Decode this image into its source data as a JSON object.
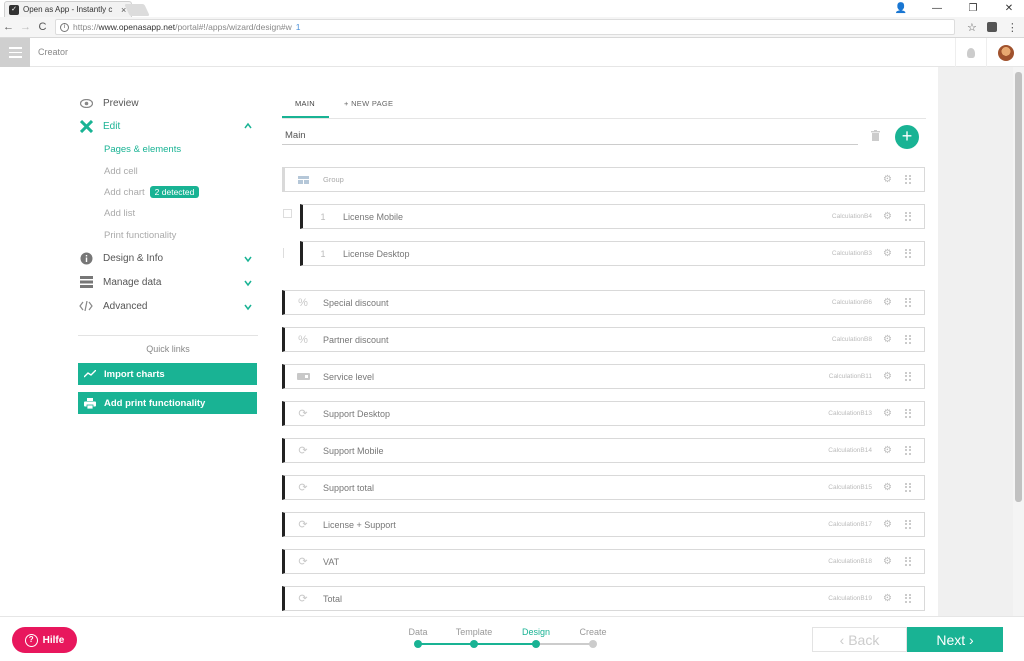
{
  "browser": {
    "tab_title": "Open as App - Instantly c",
    "tab_close": "×",
    "url_prefix": "https://",
    "url_host": "www.openasapp.net",
    "url_path": "/portal#!/apps/wizard/design#w",
    "url_suffix": "1",
    "controls": {
      "minimize": "—",
      "maximize": "❐",
      "close": "✕",
      "account": "👤"
    },
    "nav": {
      "back": "←",
      "forward": "→",
      "reload": "C"
    },
    "star": "☆",
    "menu": "⋮"
  },
  "header": {
    "title": "Creator"
  },
  "sidebar": {
    "menu": [
      {
        "label": "Preview",
        "icon": "eye-icon"
      },
      {
        "label": "Edit",
        "icon": "tools-icon",
        "active": true
      },
      {
        "label": "Design & Info",
        "icon": "info-icon"
      },
      {
        "label": "Manage data",
        "icon": "database-icon"
      },
      {
        "label": "Advanced",
        "icon": "code-icon"
      }
    ],
    "edit_submenu": [
      {
        "label": "Pages & elements",
        "active": true
      },
      {
        "label": "Add cell"
      },
      {
        "label": "Add chart",
        "badge": "2 detected"
      },
      {
        "label": "Add list"
      },
      {
        "label": "Print functionality"
      }
    ],
    "quick_links_title": "Quick links",
    "quick_links": [
      {
        "label": "Import charts",
        "icon": "chart-icon"
      },
      {
        "label": "Add print functionality",
        "icon": "printer-icon"
      }
    ]
  },
  "main": {
    "tabs": [
      {
        "label": "MAIN",
        "active": true
      },
      {
        "label": "+ NEW PAGE"
      }
    ],
    "page_name": "Main",
    "add_label": "+",
    "group_label": "Group",
    "rows": [
      {
        "num": "1",
        "label": "License Mobile",
        "ref": "CalculationB4"
      },
      {
        "num": "1",
        "label": "License Desktop",
        "ref": "CalculationB3"
      },
      {
        "icon": "percent-icon",
        "label": "Special discount",
        "ref": "CalculationB6"
      },
      {
        "icon": "percent-icon",
        "label": "Partner discount",
        "ref": "CalculationB8"
      },
      {
        "icon": "slider-icon",
        "label": "Service level",
        "ref": "CalculationB11"
      },
      {
        "icon": "refresh-icon",
        "label": "Support Desktop",
        "ref": "CalculationB13"
      },
      {
        "icon": "refresh-icon",
        "label": "Support Mobile",
        "ref": "CalculationB14"
      },
      {
        "icon": "refresh-icon",
        "label": "Support total",
        "ref": "CalculationB15"
      },
      {
        "icon": "refresh-icon",
        "label": "License + Support",
        "ref": "CalculationB17"
      },
      {
        "icon": "refresh-icon",
        "label": "VAT",
        "ref": "CalculationB18"
      },
      {
        "icon": "refresh-icon",
        "label": "Total",
        "ref": "CalculationB19"
      }
    ]
  },
  "footer": {
    "help_label": "Hilfe",
    "help_icon_glyph": "?",
    "steps": [
      {
        "label": "Data",
        "done": true
      },
      {
        "label": "Template",
        "done": true
      },
      {
        "label": "Design",
        "active": true
      },
      {
        "label": "Create"
      }
    ],
    "back_label": "‹ Back",
    "next_label": "Next ›"
  },
  "colors": {
    "accent": "#19b394",
    "help": "#e8175d",
    "dark_bar": "#222222"
  }
}
